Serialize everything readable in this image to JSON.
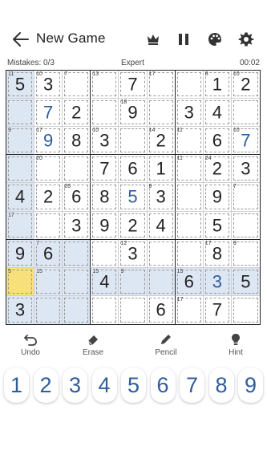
{
  "header": {
    "title": "New Game",
    "icons": [
      "back-arrow-icon",
      "crown-icon",
      "pause-icon",
      "palette-icon",
      "gear-icon"
    ]
  },
  "status": {
    "mistakes": "Mistakes: 0/3",
    "difficulty": "Expert",
    "timer": "00:02"
  },
  "board": {
    "cells": [
      [
        {
          "v": "5",
          "s": "11",
          "hl": true
        },
        {
          "v": "3",
          "s": "10"
        },
        {
          "v": "",
          "s": "7"
        },
        {
          "v": "",
          "s": "13"
        },
        {
          "v": "7"
        },
        {
          "v": "",
          "s": "17"
        },
        {
          "v": ""
        },
        {
          "v": "1",
          "s": "8"
        },
        {
          "v": "2",
          "s": "10"
        }
      ],
      [
        {
          "v": "",
          "hl": true
        },
        {
          "v": "7",
          "blue": true
        },
        {
          "v": "2"
        },
        {
          "v": ""
        },
        {
          "v": "9",
          "s": "18"
        },
        {
          "v": ""
        },
        {
          "v": "3"
        },
        {
          "v": "4"
        },
        {
          "v": ""
        }
      ],
      [
        {
          "v": "",
          "s": "9",
          "hl": true
        },
        {
          "v": "9",
          "s": "17",
          "blue": true
        },
        {
          "v": "8"
        },
        {
          "v": "3",
          "s": "10"
        },
        {
          "v": ""
        },
        {
          "v": "2",
          "s": "14"
        },
        {
          "v": "",
          "s": "11"
        },
        {
          "v": "6"
        },
        {
          "v": "7",
          "s": "10",
          "blue": true
        }
      ],
      [
        {
          "v": "",
          "hl": true
        },
        {
          "v": "",
          "s": "20"
        },
        {
          "v": ""
        },
        {
          "v": "7"
        },
        {
          "v": "6"
        },
        {
          "v": "1"
        },
        {
          "v": "",
          "s": "11"
        },
        {
          "v": "2",
          "s": "24"
        },
        {
          "v": "3"
        }
      ],
      [
        {
          "v": "4",
          "hl": true
        },
        {
          "v": "2"
        },
        {
          "v": "6",
          "s": "26"
        },
        {
          "v": "8"
        },
        {
          "v": "5",
          "blue": true
        },
        {
          "v": "3",
          "s": "9"
        },
        {
          "v": ""
        },
        {
          "v": "9"
        },
        {
          "v": "",
          "s": "7"
        }
      ],
      [
        {
          "v": "",
          "s": "17",
          "hl": true
        },
        {
          "v": ""
        },
        {
          "v": "3"
        },
        {
          "v": "9"
        },
        {
          "v": "2"
        },
        {
          "v": "4"
        },
        {
          "v": ""
        },
        {
          "v": "5"
        },
        {
          "v": ""
        }
      ],
      [
        {
          "v": "9",
          "hl": true
        },
        {
          "v": "6",
          "s": "7",
          "hl": true
        },
        {
          "v": "",
          "hl": true
        },
        {
          "v": ""
        },
        {
          "v": "3",
          "s": "12"
        },
        {
          "v": ""
        },
        {
          "v": ""
        },
        {
          "v": "8",
          "s": "17"
        },
        {
          "v": "",
          "s": "9"
        }
      ],
      [
        {
          "v": "",
          "s": "5",
          "sel": true
        },
        {
          "v": "",
          "s": "15",
          "hl": true
        },
        {
          "v": "",
          "hl": true
        },
        {
          "v": "4",
          "s": "15",
          "hl": true
        },
        {
          "v": "",
          "s": "9",
          "hl": true
        },
        {
          "v": "",
          "hl": true
        },
        {
          "v": "6",
          "s": "15",
          "hl": true
        },
        {
          "v": "3",
          "blue": true,
          "hl": true
        },
        {
          "v": "5",
          "hl": true
        }
      ],
      [
        {
          "v": "3",
          "hl": true
        },
        {
          "v": "",
          "hl": true
        },
        {
          "v": "",
          "hl": true
        },
        {
          "v": ""
        },
        {
          "v": ""
        },
        {
          "v": "6"
        },
        {
          "v": "",
          "s": "17"
        },
        {
          "v": "7"
        },
        {
          "v": ""
        }
      ]
    ]
  },
  "tools": {
    "undo": "Undo",
    "erase": "Erase",
    "pencil": "Pencil",
    "hint": "Hint"
  },
  "numpad": [
    "1",
    "2",
    "3",
    "4",
    "5",
    "6",
    "7",
    "8",
    "9"
  ],
  "colors": {
    "accent": "#2f5d9a",
    "highlight": "#dde6f3",
    "selected": "#f7e07a"
  }
}
